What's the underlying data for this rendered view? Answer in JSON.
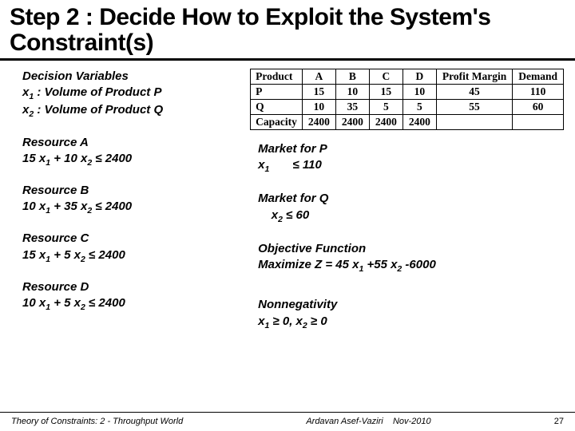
{
  "title_line1": "Step 2 : Decide How to Exploit the System's",
  "title_line2": "Constraint(s)",
  "dec": {
    "header": "Decision Variables",
    "x1": "x",
    "x1s": "1",
    "x1rest": " : Volume of Product P",
    "x2": "x",
    "x2s": "2",
    "x2rest": " : Volume of Product Q"
  },
  "resA": {
    "name": "Resource A",
    "expr_a": "15 x",
    "expr_as": "1",
    "expr_b": " + 10 x",
    "expr_bs": "2",
    "expr_c": " ≤  2400"
  },
  "resB": {
    "name": "Resource B",
    "expr_a": "10 x",
    "expr_as": "1",
    "expr_b": " + 35 x",
    "expr_bs": "2",
    "expr_c": " ≤  2400"
  },
  "resC": {
    "name": "Resource C",
    "expr_a": "15 x",
    "expr_as": "1",
    "expr_b": " + 5 x",
    "expr_bs": "2",
    "expr_c": " ≤  2400"
  },
  "resD": {
    "name": "Resource D",
    "expr_a": "10 x",
    "expr_as": "1",
    "expr_b": " + 5 x",
    "expr_bs": "2",
    "expr_c": " ≤  2400"
  },
  "table": {
    "headers": [
      "Product",
      "A",
      "B",
      "C",
      "D",
      "Profit Margin",
      "Demand"
    ],
    "rows": [
      [
        "P",
        "15",
        "10",
        "15",
        "10",
        "45",
        "110"
      ],
      [
        "Q",
        "10",
        "35",
        "5",
        "5",
        "55",
        "60"
      ],
      [
        "Capacity",
        "2400",
        "2400",
        "2400",
        "2400",
        "",
        ""
      ]
    ]
  },
  "mktP": {
    "name": "Market for P",
    "v": "x",
    "vs": "1",
    "pad": "      ",
    "rest": " ≤  110"
  },
  "mktQ": {
    "name": "Market for Q",
    "pad": "    ",
    "v": "x",
    "vs": "2",
    "rest": " ≤  60"
  },
  "obj": {
    "name": "Objective Function",
    "l1": "Maximize Z = 45 x",
    "l1s": "1",
    "l2": " +55 x",
    "l2s": "2",
    "l3": " -6000"
  },
  "nonneg": {
    "name": "Nonnegativity",
    "a": "x",
    "as": "1",
    "mid": " ≥ 0, x",
    "bs": "2",
    "end": " ≥ 0"
  },
  "footer": {
    "left": "Theory of Constraints:  2 - Throughput World",
    "mid_a": "Ardavan Asef-Vaziri",
    "mid_b": "Nov-2010",
    "page": "27"
  },
  "chart_data": {
    "type": "table",
    "title": "Product resource usage, margin, demand",
    "columns": [
      "Product",
      "A",
      "B",
      "C",
      "D",
      "Profit Margin",
      "Demand"
    ],
    "rows": [
      {
        "Product": "P",
        "A": 15,
        "B": 10,
        "C": 15,
        "D": 10,
        "Profit Margin": 45,
        "Demand": 110
      },
      {
        "Product": "Q",
        "A": 10,
        "B": 35,
        "C": 5,
        "D": 5,
        "Profit Margin": 55,
        "Demand": 60
      },
      {
        "Product": "Capacity",
        "A": 2400,
        "B": 2400,
        "C": 2400,
        "D": 2400,
        "Profit Margin": null,
        "Demand": null
      }
    ]
  }
}
